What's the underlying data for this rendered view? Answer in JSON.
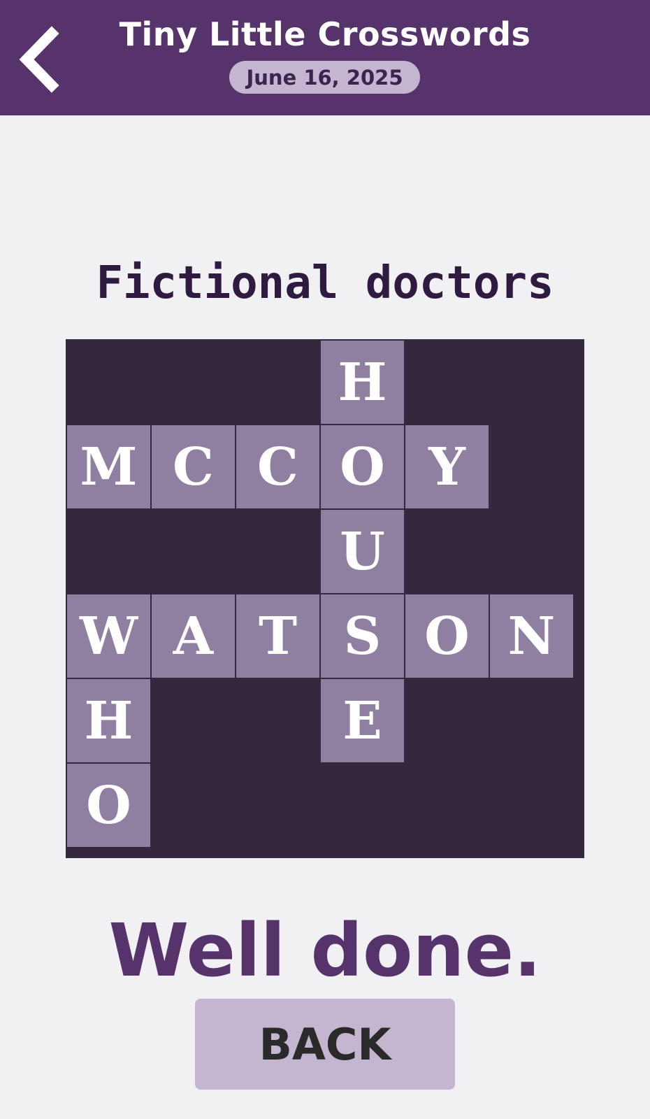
{
  "header": {
    "app_title": "Tiny Little Crosswords",
    "date": "June 16, 2025",
    "back_icon": "chevron-left-icon"
  },
  "puzzle": {
    "title": "Fictional doctors",
    "rows": 6,
    "cols": 6,
    "cells": [
      {
        "row": 0,
        "col": 3,
        "letter": "H"
      },
      {
        "row": 1,
        "col": 0,
        "letter": "M"
      },
      {
        "row": 1,
        "col": 1,
        "letter": "C"
      },
      {
        "row": 1,
        "col": 2,
        "letter": "C"
      },
      {
        "row": 1,
        "col": 3,
        "letter": "O"
      },
      {
        "row": 1,
        "col": 4,
        "letter": "Y"
      },
      {
        "row": 2,
        "col": 3,
        "letter": "U"
      },
      {
        "row": 3,
        "col": 0,
        "letter": "W"
      },
      {
        "row": 3,
        "col": 1,
        "letter": "A"
      },
      {
        "row": 3,
        "col": 2,
        "letter": "T"
      },
      {
        "row": 3,
        "col": 3,
        "letter": "S"
      },
      {
        "row": 3,
        "col": 4,
        "letter": "O"
      },
      {
        "row": 3,
        "col": 5,
        "letter": "N"
      },
      {
        "row": 4,
        "col": 0,
        "letter": "H"
      },
      {
        "row": 4,
        "col": 3,
        "letter": "E"
      },
      {
        "row": 5,
        "col": 0,
        "letter": "O"
      }
    ]
  },
  "result": {
    "message": "Well done.",
    "back_button_label": "BACK"
  },
  "colors": {
    "header_bg": "#56336b",
    "grid_bg": "#33283d",
    "cell_bg": "#8f7fa0",
    "pill_bg": "#c4b5d0",
    "page_bg": "#f1f0f3"
  }
}
